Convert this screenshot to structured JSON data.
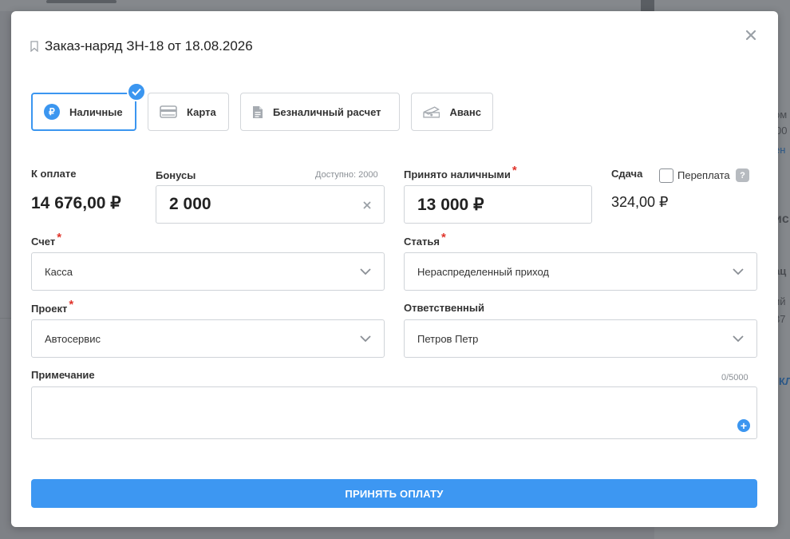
{
  "background": {
    "right_fragments": [
      "ом",
      "00",
      "ен",
      "ис",
      "ац",
      "ий",
      "37",
      "КЛ"
    ]
  },
  "modal": {
    "title": "Заказ-наряд ЗН-18 от 18.08.2026"
  },
  "payment_methods": [
    {
      "label": "Наличные",
      "icon": "ruble-icon",
      "active": true
    },
    {
      "label": "Карта",
      "icon": "credit-card-icon",
      "active": false
    },
    {
      "label": "Безналичный расчет",
      "icon": "document-icon",
      "active": false
    },
    {
      "label": "Аванс",
      "icon": "cash-icon",
      "active": false
    }
  ],
  "to_pay": {
    "label": "К оплате",
    "value": "14 676,00 ₽"
  },
  "bonuses": {
    "label": "Бонусы",
    "available": "Доступно: 2000",
    "value": "2 000"
  },
  "cash_received": {
    "label": "Принято наличными",
    "required_mark": "*",
    "value": "13 000 ₽"
  },
  "change": {
    "label": "Сдача",
    "value": "324,00 ₽"
  },
  "overpayment": {
    "label": "Переплата",
    "checked": false,
    "help": "?"
  },
  "account": {
    "label": "Счет",
    "required_mark": "*",
    "value": "Касса"
  },
  "article": {
    "label": "Статья",
    "required_mark": "*",
    "value": "Нераспределенный приход"
  },
  "project": {
    "label": "Проект",
    "required_mark": "*",
    "value": "Автосервис"
  },
  "responsible": {
    "label": "Ответственный",
    "value": "Петров Петр"
  },
  "note": {
    "label": "Примечание",
    "counter": "0/5000",
    "value": ""
  },
  "submit": {
    "label": "ПРИНЯТЬ ОПЛАТУ"
  },
  "colors": {
    "accent": "#3b96f0",
    "required": "#e0342b",
    "border": "#cfd3d8"
  }
}
